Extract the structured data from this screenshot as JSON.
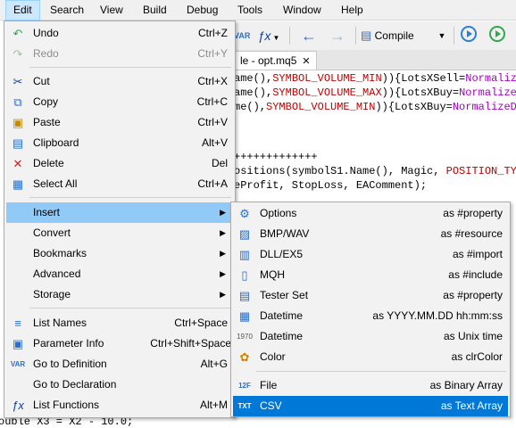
{
  "menubar": [
    "Edit",
    "Search",
    "View",
    "Build",
    "Debug",
    "Tools",
    "Window",
    "Help"
  ],
  "toolbar": {
    "compile_label": "Compile",
    "fx_label": "ƒx"
  },
  "tab": {
    "label": "le - opt.mq5",
    "close": "✕"
  },
  "code_lines": [
    {
      "a": "ame(),",
      "b": "SYMBOL_VOLUME_MIN",
      "c": ")){LotsXSell=",
      "d": "NormalizeD"
    },
    {
      "a": "ame(),",
      "b": "SYMBOL_VOLUME_MAX",
      "c": ")){LotsXBuy=",
      "d": "NormalizeDo"
    },
    {
      "a": "me(),",
      "b": "SYMBOL_VOLUME_MIN",
      "c": ")){LotsXBuy=",
      "d": "NormalizeDou"
    }
  ],
  "code_lines2": [
    {
      "a": "+++++++++++++",
      "b": "",
      "c": "",
      "d": ""
    },
    {
      "a": "ositions(symbolS1.Name(), Magic, ",
      "b": "POSITION_TYPE",
      "c": "",
      "d": ""
    },
    {
      "a": "eProfit, StopLoss, EAComment);",
      "b": "",
      "c": "",
      "d": ""
    }
  ],
  "code_bottom": "ouble X3 = X2 - 10.0;",
  "edit_menu": [
    {
      "icon": "undo-icon",
      "glyph": "↶",
      "label": "Undo",
      "shortcut": "Ctrl+Z",
      "disabled": false
    },
    {
      "icon": "redo-icon",
      "glyph": "↷",
      "label": "Redo",
      "shortcut": "Ctrl+Y",
      "disabled": true
    },
    {
      "sep": true
    },
    {
      "icon": "cut-icon",
      "glyph": "✂",
      "label": "Cut",
      "shortcut": "Ctrl+X",
      "disabled": false
    },
    {
      "icon": "copy-icon",
      "glyph": "⧉",
      "label": "Copy",
      "shortcut": "Ctrl+C",
      "disabled": false
    },
    {
      "icon": "paste-icon",
      "glyph": "📋",
      "label": "Paste",
      "shortcut": "Ctrl+V",
      "disabled": false
    },
    {
      "icon": "clipboard-icon",
      "glyph": "▤",
      "label": "Clipboard",
      "shortcut": "Alt+V",
      "disabled": false
    },
    {
      "icon": "delete-icon",
      "glyph": "✕",
      "label": "Delete",
      "shortcut": "Del",
      "disabled": false
    },
    {
      "icon": "select-all-icon",
      "glyph": "▦",
      "label": "Select All",
      "shortcut": "Ctrl+A",
      "disabled": false
    },
    {
      "sep": true
    },
    {
      "icon": "",
      "glyph": "",
      "label": "Insert",
      "shortcut": "",
      "submenu": true,
      "highlight": true
    },
    {
      "icon": "",
      "glyph": "",
      "label": "Convert",
      "shortcut": "",
      "submenu": true
    },
    {
      "icon": "",
      "glyph": "",
      "label": "Bookmarks",
      "shortcut": "",
      "submenu": true
    },
    {
      "icon": "",
      "glyph": "",
      "label": "Advanced",
      "shortcut": "",
      "submenu": true
    },
    {
      "icon": "",
      "glyph": "",
      "label": "Storage",
      "shortcut": "",
      "submenu": true
    },
    {
      "sep": true
    },
    {
      "icon": "list-names-icon",
      "glyph": "≡",
      "label": "List Names",
      "shortcut": "Ctrl+Space"
    },
    {
      "icon": "parameter-info-icon",
      "glyph": "▣",
      "label": "Parameter Info",
      "shortcut": "Ctrl+Shift+Space"
    },
    {
      "icon": "var-definition-icon",
      "glyph": "VAR",
      "label": "Go to Definition",
      "shortcut": "Alt+G"
    },
    {
      "icon": "",
      "glyph": "",
      "label": "Go to Declaration",
      "shortcut": ""
    },
    {
      "icon": "list-functions-icon",
      "glyph": "ƒx",
      "label": "List Functions",
      "shortcut": "Alt+M"
    }
  ],
  "insert_menu": [
    {
      "icon": "gear-icon",
      "glyph": "⚙",
      "label": "Options",
      "right": "as #property",
      "color": "#2a6fc9"
    },
    {
      "icon": "image-icon",
      "glyph": "▨",
      "label": "BMP/WAV",
      "right": "as #resource",
      "color": "#2a6fc9"
    },
    {
      "icon": "dll-icon",
      "glyph": "▥",
      "label": "DLL/EX5",
      "right": "as #import",
      "color": "#2a6fc9"
    },
    {
      "icon": "file-icon",
      "glyph": "▯",
      "label": "MQH",
      "right": "as #include",
      "color": "#2a6fc9"
    },
    {
      "icon": "tester-icon",
      "glyph": "▤",
      "label": "Tester Set",
      "right": "as #property",
      "color": "#2a6fc9"
    },
    {
      "icon": "calendar-icon",
      "glyph": "▦",
      "label": "Datetime",
      "right": "as YYYY.MM.DD hh:mm:ss",
      "color": "#2a6fc9"
    },
    {
      "icon": "unix-time-icon",
      "glyph": "1970",
      "label": "Datetime",
      "right": "as Unix time",
      "color": "#555555"
    },
    {
      "icon": "palette-icon",
      "glyph": "✿",
      "label": "Color",
      "right": "as clrColor",
      "color": "#d08000"
    },
    {
      "sep": true
    },
    {
      "icon": "binary-file-icon",
      "glyph": "12F",
      "label": "File",
      "right": "as Binary Array",
      "color": "#2a6fc9"
    },
    {
      "icon": "text-file-icon",
      "glyph": "TXT",
      "label": "CSV",
      "right": "as Text Array",
      "color": "#2a6fc9",
      "selected": true
    }
  ]
}
